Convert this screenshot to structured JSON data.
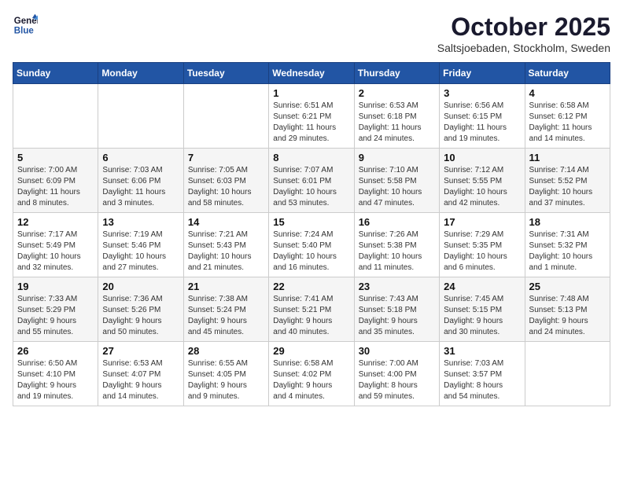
{
  "header": {
    "logo_line1": "General",
    "logo_line2": "Blue",
    "month_title": "October 2025",
    "location": "Saltsjoebaden, Stockholm, Sweden"
  },
  "weekdays": [
    "Sunday",
    "Monday",
    "Tuesday",
    "Wednesday",
    "Thursday",
    "Friday",
    "Saturday"
  ],
  "weeks": [
    [
      {
        "day": "",
        "info": ""
      },
      {
        "day": "",
        "info": ""
      },
      {
        "day": "",
        "info": ""
      },
      {
        "day": "1",
        "info": "Sunrise: 6:51 AM\nSunset: 6:21 PM\nDaylight: 11 hours\nand 29 minutes."
      },
      {
        "day": "2",
        "info": "Sunrise: 6:53 AM\nSunset: 6:18 PM\nDaylight: 11 hours\nand 24 minutes."
      },
      {
        "day": "3",
        "info": "Sunrise: 6:56 AM\nSunset: 6:15 PM\nDaylight: 11 hours\nand 19 minutes."
      },
      {
        "day": "4",
        "info": "Sunrise: 6:58 AM\nSunset: 6:12 PM\nDaylight: 11 hours\nand 14 minutes."
      }
    ],
    [
      {
        "day": "5",
        "info": "Sunrise: 7:00 AM\nSunset: 6:09 PM\nDaylight: 11 hours\nand 8 minutes."
      },
      {
        "day": "6",
        "info": "Sunrise: 7:03 AM\nSunset: 6:06 PM\nDaylight: 11 hours\nand 3 minutes."
      },
      {
        "day": "7",
        "info": "Sunrise: 7:05 AM\nSunset: 6:03 PM\nDaylight: 10 hours\nand 58 minutes."
      },
      {
        "day": "8",
        "info": "Sunrise: 7:07 AM\nSunset: 6:01 PM\nDaylight: 10 hours\nand 53 minutes."
      },
      {
        "day": "9",
        "info": "Sunrise: 7:10 AM\nSunset: 5:58 PM\nDaylight: 10 hours\nand 47 minutes."
      },
      {
        "day": "10",
        "info": "Sunrise: 7:12 AM\nSunset: 5:55 PM\nDaylight: 10 hours\nand 42 minutes."
      },
      {
        "day": "11",
        "info": "Sunrise: 7:14 AM\nSunset: 5:52 PM\nDaylight: 10 hours\nand 37 minutes."
      }
    ],
    [
      {
        "day": "12",
        "info": "Sunrise: 7:17 AM\nSunset: 5:49 PM\nDaylight: 10 hours\nand 32 minutes."
      },
      {
        "day": "13",
        "info": "Sunrise: 7:19 AM\nSunset: 5:46 PM\nDaylight: 10 hours\nand 27 minutes."
      },
      {
        "day": "14",
        "info": "Sunrise: 7:21 AM\nSunset: 5:43 PM\nDaylight: 10 hours\nand 21 minutes."
      },
      {
        "day": "15",
        "info": "Sunrise: 7:24 AM\nSunset: 5:40 PM\nDaylight: 10 hours\nand 16 minutes."
      },
      {
        "day": "16",
        "info": "Sunrise: 7:26 AM\nSunset: 5:38 PM\nDaylight: 10 hours\nand 11 minutes."
      },
      {
        "day": "17",
        "info": "Sunrise: 7:29 AM\nSunset: 5:35 PM\nDaylight: 10 hours\nand 6 minutes."
      },
      {
        "day": "18",
        "info": "Sunrise: 7:31 AM\nSunset: 5:32 PM\nDaylight: 10 hours\nand 1 minute."
      }
    ],
    [
      {
        "day": "19",
        "info": "Sunrise: 7:33 AM\nSunset: 5:29 PM\nDaylight: 9 hours\nand 55 minutes."
      },
      {
        "day": "20",
        "info": "Sunrise: 7:36 AM\nSunset: 5:26 PM\nDaylight: 9 hours\nand 50 minutes."
      },
      {
        "day": "21",
        "info": "Sunrise: 7:38 AM\nSunset: 5:24 PM\nDaylight: 9 hours\nand 45 minutes."
      },
      {
        "day": "22",
        "info": "Sunrise: 7:41 AM\nSunset: 5:21 PM\nDaylight: 9 hours\nand 40 minutes."
      },
      {
        "day": "23",
        "info": "Sunrise: 7:43 AM\nSunset: 5:18 PM\nDaylight: 9 hours\nand 35 minutes."
      },
      {
        "day": "24",
        "info": "Sunrise: 7:45 AM\nSunset: 5:15 PM\nDaylight: 9 hours\nand 30 minutes."
      },
      {
        "day": "25",
        "info": "Sunrise: 7:48 AM\nSunset: 5:13 PM\nDaylight: 9 hours\nand 24 minutes."
      }
    ],
    [
      {
        "day": "26",
        "info": "Sunrise: 6:50 AM\nSunset: 4:10 PM\nDaylight: 9 hours\nand 19 minutes."
      },
      {
        "day": "27",
        "info": "Sunrise: 6:53 AM\nSunset: 4:07 PM\nDaylight: 9 hours\nand 14 minutes."
      },
      {
        "day": "28",
        "info": "Sunrise: 6:55 AM\nSunset: 4:05 PM\nDaylight: 9 hours\nand 9 minutes."
      },
      {
        "day": "29",
        "info": "Sunrise: 6:58 AM\nSunset: 4:02 PM\nDaylight: 9 hours\nand 4 minutes."
      },
      {
        "day": "30",
        "info": "Sunrise: 7:00 AM\nSunset: 4:00 PM\nDaylight: 8 hours\nand 59 minutes."
      },
      {
        "day": "31",
        "info": "Sunrise: 7:03 AM\nSunset: 3:57 PM\nDaylight: 8 hours\nand 54 minutes."
      },
      {
        "day": "",
        "info": ""
      }
    ]
  ]
}
